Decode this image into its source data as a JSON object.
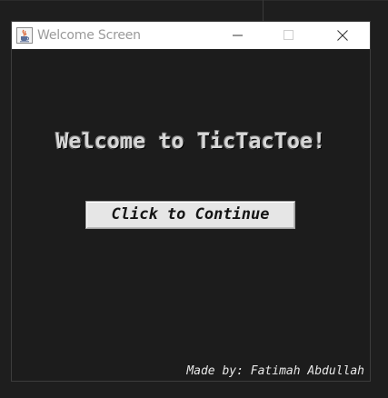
{
  "window": {
    "title": "Welcome Screen",
    "app_icon": "java-cup-icon",
    "controls": {
      "minimize_icon": "minimize-icon",
      "maximize_icon": "maximize-icon",
      "close_icon": "close-icon"
    }
  },
  "content": {
    "welcome_text": "Welcome to TicTacToe!",
    "continue_button_label": "Click to Continue",
    "credits_text": "Made by: Fatimah Abdullah"
  },
  "colors": {
    "window_background": "#1c1c1c",
    "titlebar_background": "#ffffff",
    "button_background": "#e6e6e6",
    "text_light": "#d7d7d7"
  }
}
